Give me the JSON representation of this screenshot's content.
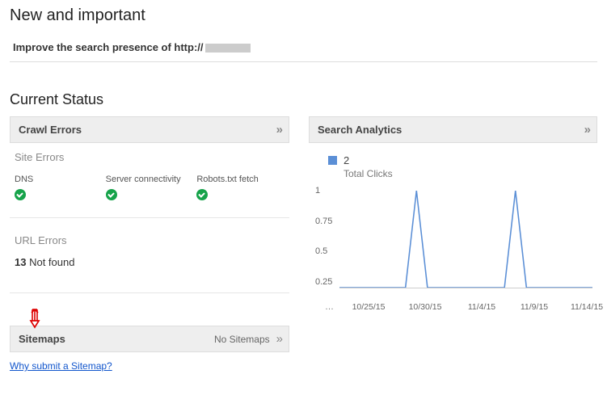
{
  "header": {
    "title": "New and important",
    "banner_prefix": "Improve the search presence of http://"
  },
  "status": {
    "title": "Current Status"
  },
  "crawl_errors": {
    "title": "Crawl Errors",
    "site_errors_label": "Site Errors",
    "columns": [
      {
        "label": "DNS",
        "status": "ok"
      },
      {
        "label": "Server connectivity",
        "status": "ok"
      },
      {
        "label": "Robots.txt fetch",
        "status": "ok"
      }
    ],
    "url_errors_label": "URL Errors",
    "url_error_count": "13",
    "url_error_text": "Not found"
  },
  "search_analytics": {
    "title": "Search Analytics",
    "legend_value": "2",
    "legend_label": "Total Clicks"
  },
  "sitemaps": {
    "title": "Sitemaps",
    "status": "No Sitemaps",
    "why_link": "Why submit a Sitemap?"
  },
  "chart_data": {
    "type": "line",
    "title": "Total Clicks",
    "ylabel": "",
    "xlabel": "",
    "ylim": [
      0,
      1
    ],
    "y_ticks": [
      1.0,
      0.75,
      0.5,
      0.25
    ],
    "x_ticks": [
      "10/25/15",
      "10/30/15",
      "11/4/15",
      "11/9/15",
      "11/14/15"
    ],
    "series": [
      {
        "name": "Total Clicks",
        "color": "#5b8fd6",
        "x": [
          "10/22/15",
          "10/23/15",
          "10/24/15",
          "10/25/15",
          "10/26/15",
          "10/27/15",
          "10/28/15",
          "10/29/15",
          "10/30/15",
          "10/31/15",
          "11/1/15",
          "11/2/15",
          "11/3/15",
          "11/4/15",
          "11/5/15",
          "11/6/15",
          "11/7/15",
          "11/8/15",
          "11/9/15",
          "11/10/15",
          "11/11/15",
          "11/12/15",
          "11/13/15",
          "11/14/15"
        ],
        "values": [
          0,
          0,
          0,
          0,
          0,
          0,
          0,
          1,
          0,
          0,
          0,
          0,
          0,
          0,
          0,
          0,
          1,
          0,
          0,
          0,
          0,
          0,
          0,
          0
        ]
      }
    ]
  }
}
